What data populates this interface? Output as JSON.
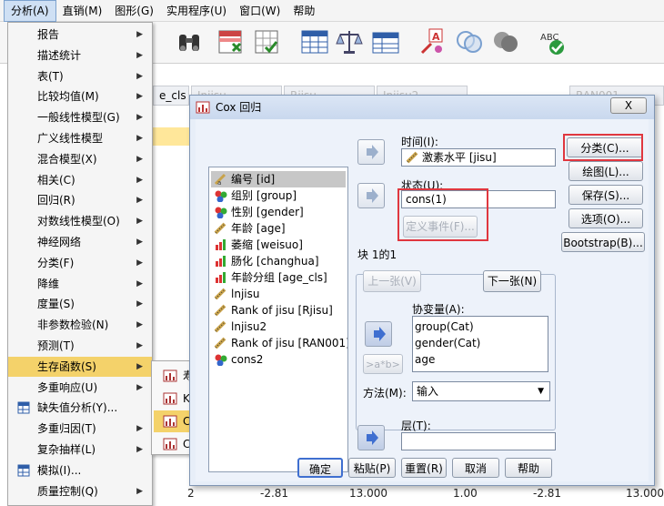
{
  "menubar": {
    "items": [
      "分析(A)",
      "直销(M)",
      "图形(G)",
      "实用程序(U)",
      "窗口(W)",
      "帮助"
    ]
  },
  "grid": {
    "headers": [
      "e_cls",
      "Injisu",
      "Rjisu",
      "Injisu2",
      "RAN001"
    ],
    "bottom_row": [
      "2",
      "-2.81",
      "13.000",
      "1.00",
      "-2.81",
      "13.000"
    ]
  },
  "analyze_menu": {
    "items": [
      {
        "label": "报告",
        "submenu": true
      },
      {
        "label": "描述统计",
        "submenu": true
      },
      {
        "label": "表(T)",
        "submenu": true
      },
      {
        "label": "比较均值(M)",
        "submenu": true
      },
      {
        "label": "一般线性模型(G)",
        "submenu": true
      },
      {
        "label": "广义线性模型",
        "submenu": true
      },
      {
        "label": "混合模型(X)",
        "submenu": true
      },
      {
        "label": "相关(C)",
        "submenu": true
      },
      {
        "label": "回归(R)",
        "submenu": true
      },
      {
        "label": "对数线性模型(O)",
        "submenu": true
      },
      {
        "label": "神经网络",
        "submenu": true
      },
      {
        "label": "分类(F)",
        "submenu": true
      },
      {
        "label": "降维",
        "submenu": true
      },
      {
        "label": "度量(S)",
        "submenu": true
      },
      {
        "label": "非参数检验(N)",
        "submenu": true
      },
      {
        "label": "预测(T)",
        "submenu": true
      },
      {
        "label": "生存函数(S)",
        "submenu": true
      },
      {
        "label": "多重响应(U)",
        "submenu": true
      },
      {
        "label": "缺失值分析(Y)...",
        "submenu": false
      },
      {
        "label": "多重归因(T)",
        "submenu": true
      },
      {
        "label": "复杂抽样(L)",
        "submenu": true
      },
      {
        "label": "模拟(I)...",
        "submenu": false
      },
      {
        "label": "质量控制(Q)",
        "submenu": true
      }
    ],
    "active_index": 16
  },
  "survival_menu": {
    "items": [
      "寿命表(L)...",
      "Kaplan-Meier...",
      "Cox 回归(C)...",
      "Cox 依时协变量(O)..."
    ],
    "active_index": 2
  },
  "dialog": {
    "title": "Cox 回归",
    "close_label": "X",
    "variables": [
      {
        "label": "编号 [id]",
        "icon": "nominal-ruler-icon",
        "selected": true
      },
      {
        "label": "组别 [group]",
        "icon": "nominal-icon"
      },
      {
        "label": "性别 [gender]",
        "icon": "nominal-icon"
      },
      {
        "label": "年龄 [age]",
        "icon": "scale-icon"
      },
      {
        "label": "萎缩 [weisuo]",
        "icon": "ordinal-icon"
      },
      {
        "label": "肠化 [changhua]",
        "icon": "ordinal-icon"
      },
      {
        "label": "年龄分组 [age_cls]",
        "icon": "ordinal-icon"
      },
      {
        "label": "lnjisu",
        "icon": "scale-icon"
      },
      {
        "label": "Rank of jisu [Rjisu]",
        "icon": "scale-icon"
      },
      {
        "label": "lnjisu2",
        "icon": "scale-icon"
      },
      {
        "label": "Rank of jisu [RAN001]",
        "icon": "scale-icon"
      },
      {
        "label": "cons2",
        "icon": "nominal-icon"
      }
    ],
    "time_label": "时间(I):",
    "time_value": "激素水平 [jisu]",
    "status_label": "状态(U):",
    "status_value": "cons(1)",
    "define_event_label": "定义事件(F)...",
    "block_label": "块 1的1",
    "prev_label": "上一张(V)",
    "next_label": "下一张(N)",
    "covariates_label": "协变量(A):",
    "covariates": [
      "group(Cat)",
      "gender(Cat)",
      "age"
    ],
    "interaction_label": ">a*b>",
    "method_label": "方法(M):",
    "method_value": "输入",
    "strata_label": "层(T):",
    "strata_value": "",
    "side_buttons": [
      "分类(C)...",
      "绘图(L)...",
      "保存(S)...",
      "选项(O)...",
      "Bootstrap(B)..."
    ],
    "bottom_buttons": [
      "确定",
      "粘贴(P)",
      "重置(R)",
      "取消",
      "帮助"
    ]
  },
  "colors": {
    "highlight": "#f4d26a",
    "annotation_red": "#e0373f",
    "dialog_bg": "#e7eef8"
  }
}
